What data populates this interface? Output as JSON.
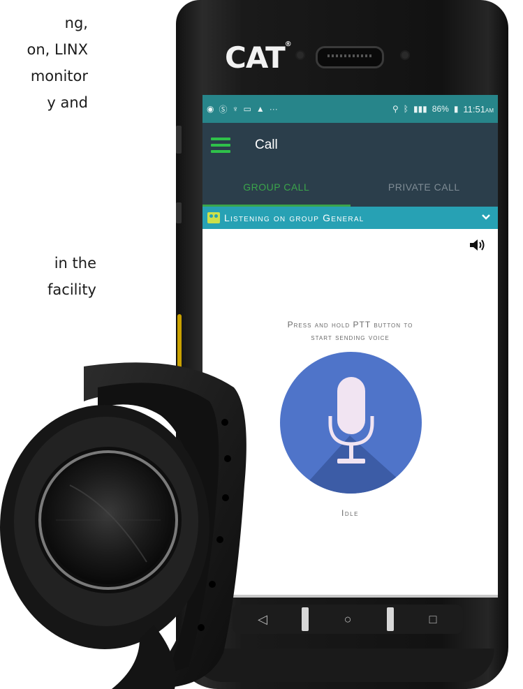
{
  "background_text": {
    "block1": [
      "ng,",
      "on, LINX",
      "monitor",
      "y and"
    ],
    "block2": [
      "in the",
      "facility"
    ]
  },
  "phone": {
    "brand": "CAT",
    "brand_mark": "®"
  },
  "statusbar": {
    "battery": "86%",
    "time": "11:51",
    "ampm": "AM"
  },
  "appbar": {
    "title": "Call",
    "menu_icon": "hamburger-icon"
  },
  "tabs": [
    {
      "label": "GROUP CALL",
      "active": true
    },
    {
      "label": "PRIVATE CALL",
      "active": false
    }
  ],
  "group_bar": {
    "text": "Listening on group General",
    "icon": "group-icon",
    "chevron": "chevron-down-icon"
  },
  "main": {
    "instruction_line1": "Press and hold PTT button to",
    "instruction_line2": "start sending voice",
    "status": "Idle"
  },
  "nav": {
    "back": "◁",
    "home": "○",
    "recents": "□"
  },
  "colors": {
    "statusbar": "#27858a",
    "appbar": "#2b3e4b",
    "accent_green": "#3ba54b",
    "group_bar": "#27a1b4",
    "ptt_button": "#4f74c9"
  }
}
